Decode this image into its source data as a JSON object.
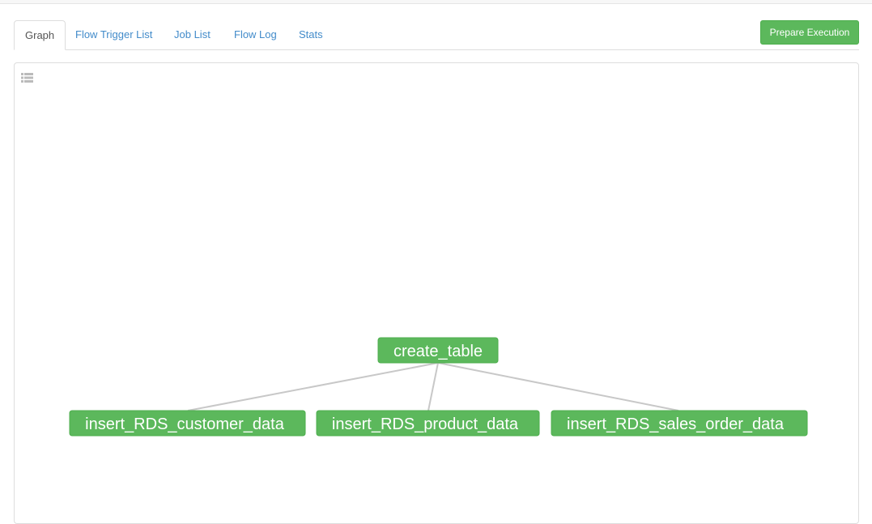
{
  "tabs": [
    {
      "label": "Graph",
      "active": true
    },
    {
      "label": "Flow Trigger List",
      "active": false
    },
    {
      "label": "Job List",
      "active": false
    },
    {
      "label": "Flow Log",
      "active": false
    },
    {
      "label": "Stats",
      "active": false
    }
  ],
  "actions": {
    "prepare_execution_label": "Prepare Execution"
  },
  "graph": {
    "toolbar_icon": "list-icon",
    "node_color": "#5cb85c",
    "edge_color": "#c8c8c8",
    "nodes": [
      {
        "id": "create_table",
        "label": "create_table"
      },
      {
        "id": "insert_RDS_customer_data",
        "label": "insert_RDS_customer_data"
      },
      {
        "id": "insert_RDS_product_data",
        "label": "insert_RDS_product_data"
      },
      {
        "id": "insert_RDS_sales_order_data",
        "label": "insert_RDS_sales_order_data"
      }
    ],
    "edges": [
      {
        "from": "create_table",
        "to": "insert_RDS_customer_data"
      },
      {
        "from": "create_table",
        "to": "insert_RDS_product_data"
      },
      {
        "from": "create_table",
        "to": "insert_RDS_sales_order_data"
      }
    ]
  }
}
